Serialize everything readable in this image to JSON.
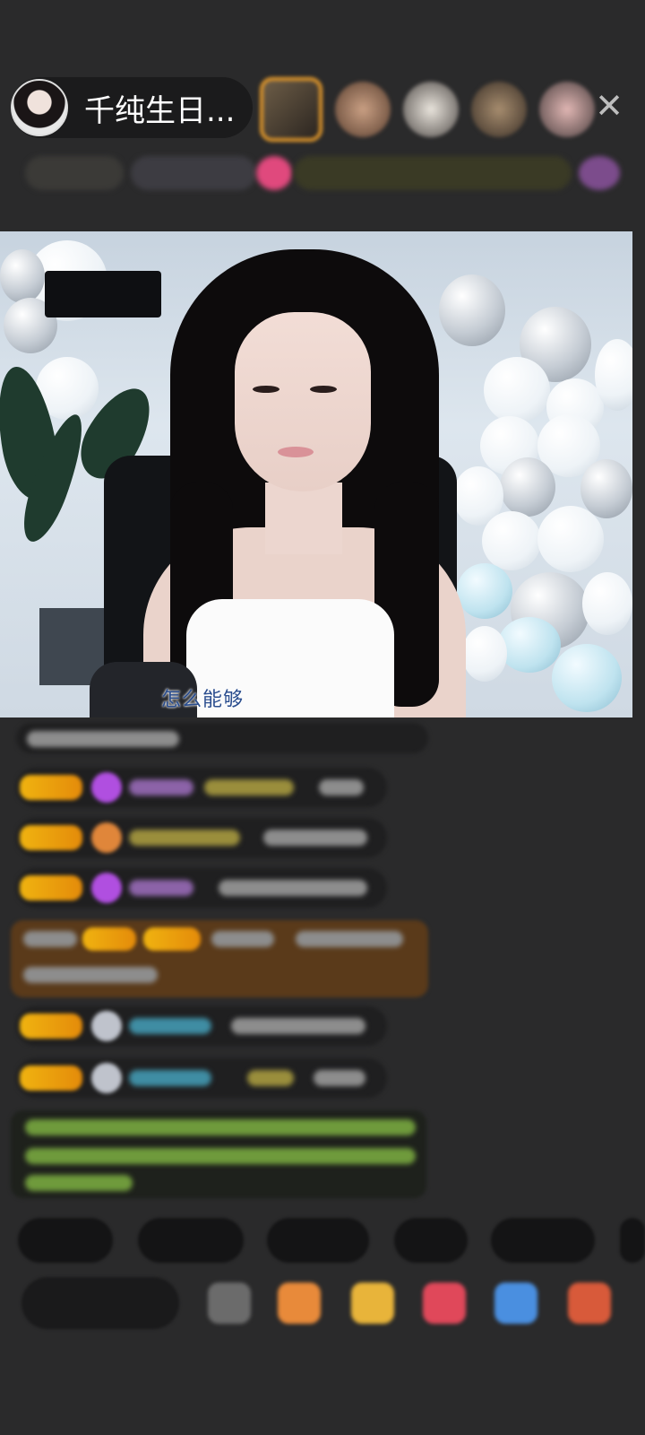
{
  "header": {
    "host_name": "千纯生日...",
    "close_icon": "close-icon",
    "viewer_count_avatars": 5
  },
  "video": {
    "subtitle": "怎么能够"
  },
  "colors": {
    "background": "#2a2a2b",
    "badge_gold": "#f0b310",
    "gift_card": "#5a3a1a"
  }
}
